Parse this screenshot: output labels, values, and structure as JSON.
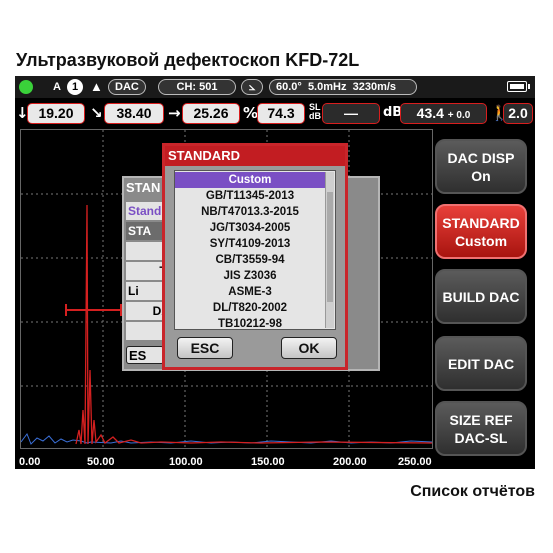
{
  "caption_top": "Ультразвуковой дефектоскоп KFD-72L",
  "caption_bottom": "Список отчётов",
  "status": {
    "gate_a": "A",
    "gate_num": "1",
    "dac": "DAC",
    "channel": "CH: 501",
    "angle": "60.0°",
    "frequency": "5.0mHz",
    "velocity": "3230m/s"
  },
  "measure": {
    "down_value": "19.20",
    "diag_value": "38.40",
    "right_value": "25.26",
    "percent_label": "%",
    "percent_value": "74.3",
    "sl_label": "SL",
    "db_small_label": "dB",
    "sl_value": "—",
    "db_label": "dB",
    "gain_value": "43.4",
    "gain_offset": "+ 0.0",
    "step_value": "2.0"
  },
  "axis": [
    "0.00",
    "50.00",
    "100.00",
    "150.00",
    "200.00",
    "250.00"
  ],
  "side_buttons": [
    {
      "line1": "DAC DISP",
      "line2": "On"
    },
    {
      "line1": "STANDARD",
      "line2": "Custom"
    },
    {
      "line1": "BUILD DAC",
      "line2": ""
    },
    {
      "line1": "EDIT DAC",
      "line2": ""
    },
    {
      "line1": "SIZE REF",
      "line2": "DAC-SL"
    }
  ],
  "bg_dialog": {
    "title": "STAN",
    "header": "Stand",
    "rows": [
      "STA",
      "E",
      "Tl",
      "Li",
      "DA",
      "D"
    ],
    "esc": "ES"
  },
  "dialog": {
    "title": "STANDARD",
    "items": [
      "Custom",
      "GB/T11345-2013",
      "NB/T47013.3-2015",
      "JG/T3034-2005",
      "SY/T4109-2013",
      "CB/T3559-94",
      "JIS Z3036",
      "ASME-3",
      "DL/T820-2002",
      "TB10212-98"
    ],
    "esc": "ESC",
    "ok": "OK"
  },
  "colors": {
    "accent_red": "#c21d22",
    "selection": "#7a4fc4",
    "signal": "#d42020",
    "noise": "#3a6fd8"
  }
}
